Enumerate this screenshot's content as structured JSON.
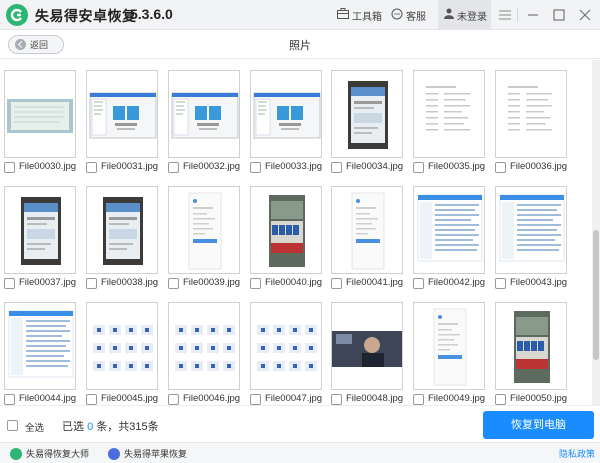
{
  "titlebar": {
    "app_name": "失易得安卓恢复",
    "version": "5.3.6.0",
    "toolbox": "工具箱",
    "service": "客服",
    "login": "未登录"
  },
  "subheader": {
    "back": "返回",
    "title": "照片"
  },
  "files": [
    "File00030.jpg",
    "File00031.jpg",
    "File00032.jpg",
    "File00033.jpg",
    "File00034.jpg",
    "File00035.jpg",
    "File00036.jpg",
    "File00037.jpg",
    "File00038.jpg",
    "File00039.jpg",
    "File00040.jpg",
    "File00041.jpg",
    "File00042.jpg",
    "File00043.jpg",
    "File00044.jpg",
    "File00045.jpg",
    "File00046.jpg",
    "File00047.jpg",
    "File00048.jpg",
    "File00049.jpg",
    "File00050.jpg"
  ],
  "bottom": {
    "select_all": "全选",
    "selected_prefix": "已选",
    "selected_count": "0",
    "selected_suffix": "条，共315条",
    "recover_button": "恢复到电脑"
  },
  "footer": {
    "link1": "失易得恢复大师",
    "link2": "失易得苹果恢复",
    "privacy": "隐私政策"
  },
  "colors": {
    "accent": "#1a8cff",
    "logo": "#2bb673"
  }
}
